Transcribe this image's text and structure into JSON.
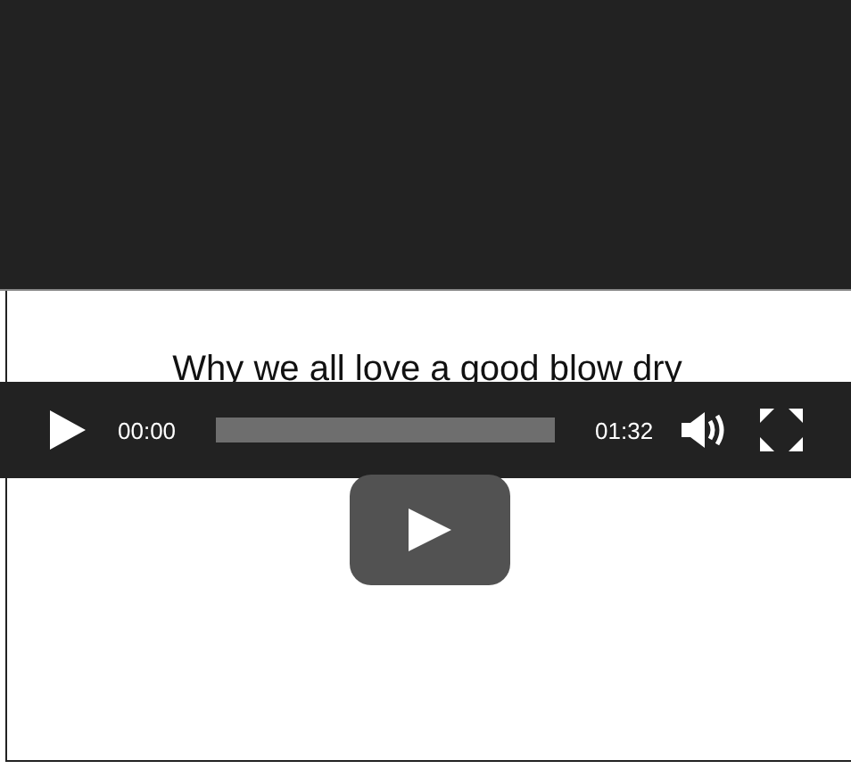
{
  "video": {
    "title": "Why we all love a good blow dry",
    "controls": {
      "current_time": "00:00",
      "duration": "01:32",
      "progress": {
        "level": 0
      }
    }
  }
}
